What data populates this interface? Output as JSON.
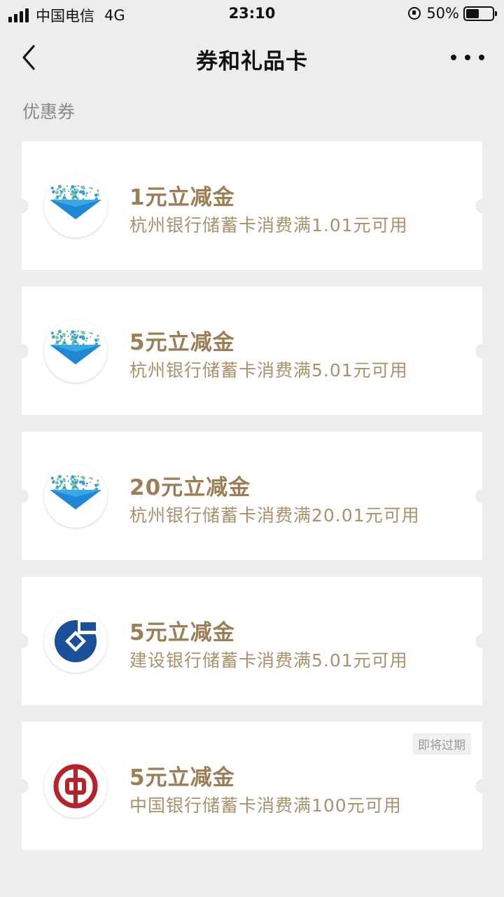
{
  "status_bar": {
    "carrier": "中国电信",
    "network": "4G",
    "time": "23:10",
    "battery": "50%",
    "battery_level": 0.5
  },
  "nav": {
    "title": "券和礼品卡"
  },
  "section": {
    "title": "优惠券"
  },
  "coupons": [
    {
      "title": "1元立减金",
      "desc": "杭州银行储蓄卡消费满1.01元可用",
      "logo": "hangzhou-bank-logo"
    },
    {
      "title": "5元立减金",
      "desc": "杭州银行储蓄卡消费满5.01元可用",
      "logo": "hangzhou-bank-logo"
    },
    {
      "title": "20元立减金",
      "desc": "杭州银行储蓄卡消费满20.01元可用",
      "logo": "hangzhou-bank-logo"
    },
    {
      "title": "5元立减金",
      "desc": "建设银行储蓄卡消费满5.01元可用",
      "logo": "ccb-logo"
    },
    {
      "title": "5元立减金",
      "desc": "中国银行储蓄卡消费满100元可用",
      "logo": "boc-logo",
      "badge": "即将过期"
    }
  ],
  "colors": {
    "accent": "#9b7e55",
    "background": "#ededed",
    "hangzhou_blue": "#1e88d6",
    "ccb_blue": "#1a4f99",
    "boc_red": "#b5242a"
  }
}
